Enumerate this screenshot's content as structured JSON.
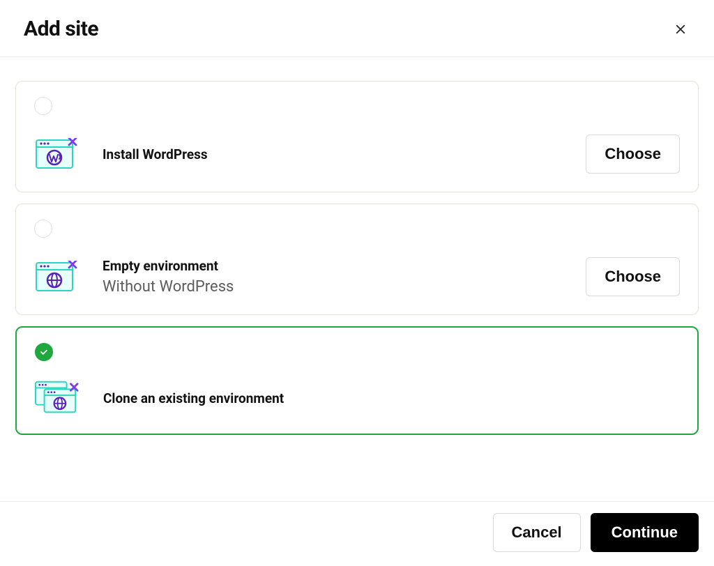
{
  "header": {
    "title": "Add site"
  },
  "options": {
    "install_wordpress": {
      "title": "Install WordPress",
      "choose_label": "Choose",
      "selected": false
    },
    "empty_env": {
      "title": "Empty environment",
      "subtitle": "Without WordPress",
      "choose_label": "Choose",
      "selected": false
    },
    "clone_env": {
      "title": "Clone an existing environment",
      "selected": true
    }
  },
  "footer": {
    "cancel_label": "Cancel",
    "continue_label": "Continue"
  }
}
